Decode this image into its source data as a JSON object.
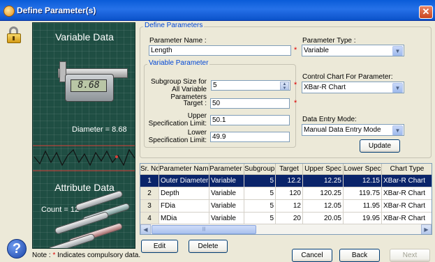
{
  "window": {
    "title": "Define Parameter(s)",
    "close_glyph": "✕"
  },
  "side_panel": {
    "variable_title": "Variable Data",
    "caliper_reading": "8.68",
    "diameter_text": "Diameter = 8.68",
    "attribute_title": "Attribute Data",
    "count_text": "Count = 12"
  },
  "define_group": {
    "legend": "Define Parameters",
    "param_name_label": "Parameter Name :",
    "param_name_value": "Length",
    "param_type_label": "Parameter Type :",
    "param_type_value": "Variable",
    "required_mark": "*"
  },
  "variable_group": {
    "legend": "Variable Parameter",
    "subgroup_label": "Subgroup Size for All Variable Parameters",
    "subgroup_value": "5",
    "target_label": "Target :",
    "target_value": "50",
    "usl_label": "Upper Specification Limit:",
    "usl_value": "50.1",
    "lsl_label": "Lower Specification Limit:",
    "lsl_value": "49.9"
  },
  "chart_group": {
    "control_chart_label": "Control Chart For Parameter:",
    "control_chart_value": "XBar-R Chart",
    "entry_mode_label": "Data Entry Mode:",
    "entry_mode_value": "Manual Data Entry Mode",
    "update_label": "Update"
  },
  "table": {
    "headers": [
      "Sr. No.",
      "Parameter Name",
      "Parameter Type",
      "Subgroup Size",
      "Target",
      "Upper Spec",
      "Lower Spec",
      "Chart Type"
    ],
    "rows": [
      {
        "sr": "1",
        "name": "Outer Diameter",
        "type": "Variable",
        "subgroup": "5",
        "target": "12.2",
        "upper": "12.25",
        "lower": "12.15",
        "chart": "XBar-R Chart"
      },
      {
        "sr": "2",
        "name": "Depth",
        "type": "Variable",
        "subgroup": "5",
        "target": "120",
        "upper": "120.25",
        "lower": "119.75",
        "chart": "XBar-R Chart"
      },
      {
        "sr": "3",
        "name": "FDia",
        "type": "Variable",
        "subgroup": "5",
        "target": "12",
        "upper": "12.05",
        "lower": "11.95",
        "chart": "XBar-R Chart"
      },
      {
        "sr": "4",
        "name": "MDia",
        "type": "Variable",
        "subgroup": "5",
        "target": "20",
        "upper": "20.05",
        "lower": "19.95",
        "chart": "XBar-R Chart"
      }
    ],
    "selected_row": 0
  },
  "buttons": {
    "edit": "Edit",
    "delete": "Delete",
    "cancel": "Cancel",
    "back": "Back",
    "next": "Next"
  },
  "note": {
    "prefix": "Note :",
    "star": "*",
    "text": "Indicates compulsory data."
  },
  "colors": {
    "title_bar": "#0a5cd8",
    "selection": "#0a246a",
    "required": "#e00000",
    "legend_text": "#0046d5"
  }
}
